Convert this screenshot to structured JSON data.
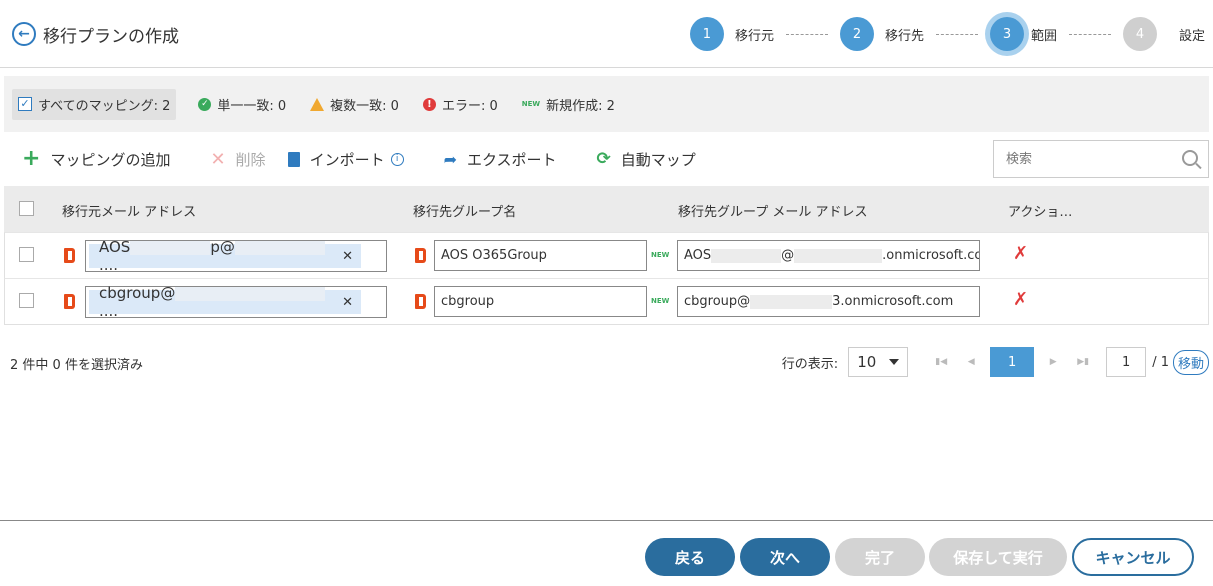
{
  "header": {
    "title": "移行プランの作成",
    "steps": [
      {
        "num": "1",
        "label": "移行元"
      },
      {
        "num": "2",
        "label": "移行先"
      },
      {
        "num": "3",
        "label": "範囲"
      },
      {
        "num": "4",
        "label": "設定"
      }
    ]
  },
  "filters": {
    "all": "すべてのマッピング: 2",
    "single": "単一一致: 0",
    "multiple": "複数一致: 0",
    "error": "エラー: 0",
    "new_badge": "NEW",
    "new": "新規作成: 2"
  },
  "toolbar": {
    "add": "マッピングの追加",
    "delete": "削除",
    "import": "インポート",
    "export": "エクスポート",
    "automap": "自動マップ",
    "search_placeholder": "検索"
  },
  "table": {
    "columns": [
      "移行元メール アドレス",
      "移行先グループ名",
      "移行先グループ メール アドレス",
      "アクショ…"
    ],
    "rows": [
      {
        "source_prefix": "AOS",
        "source_mid": "p@",
        "source_suffix": "....",
        "group_name": "AOS O365Group",
        "new_badge": "NEW",
        "email_prefix": "AOS",
        "email_mid": "@",
        "email_suffix": ".onmicrosoft.co"
      },
      {
        "source_prefix": "cbgroup@",
        "source_mid": "",
        "source_suffix": "....",
        "group_name": "cbgroup",
        "new_badge": "NEW",
        "email_prefix": "cbgroup@",
        "email_mid": "",
        "email_suffix": "3.onmicrosoft.com"
      }
    ]
  },
  "status": {
    "selected_count": "2 件中 0 件を選択済み",
    "rows_label": "行の表示:",
    "rows_value": "10",
    "current_page": "1",
    "page_input": "1",
    "total_pages": "/ 1",
    "goto": "移動"
  },
  "footer": {
    "back": "戻る",
    "next": "次へ",
    "finish": "完了",
    "save_run": "保存して実行",
    "cancel": "キャンセル"
  }
}
